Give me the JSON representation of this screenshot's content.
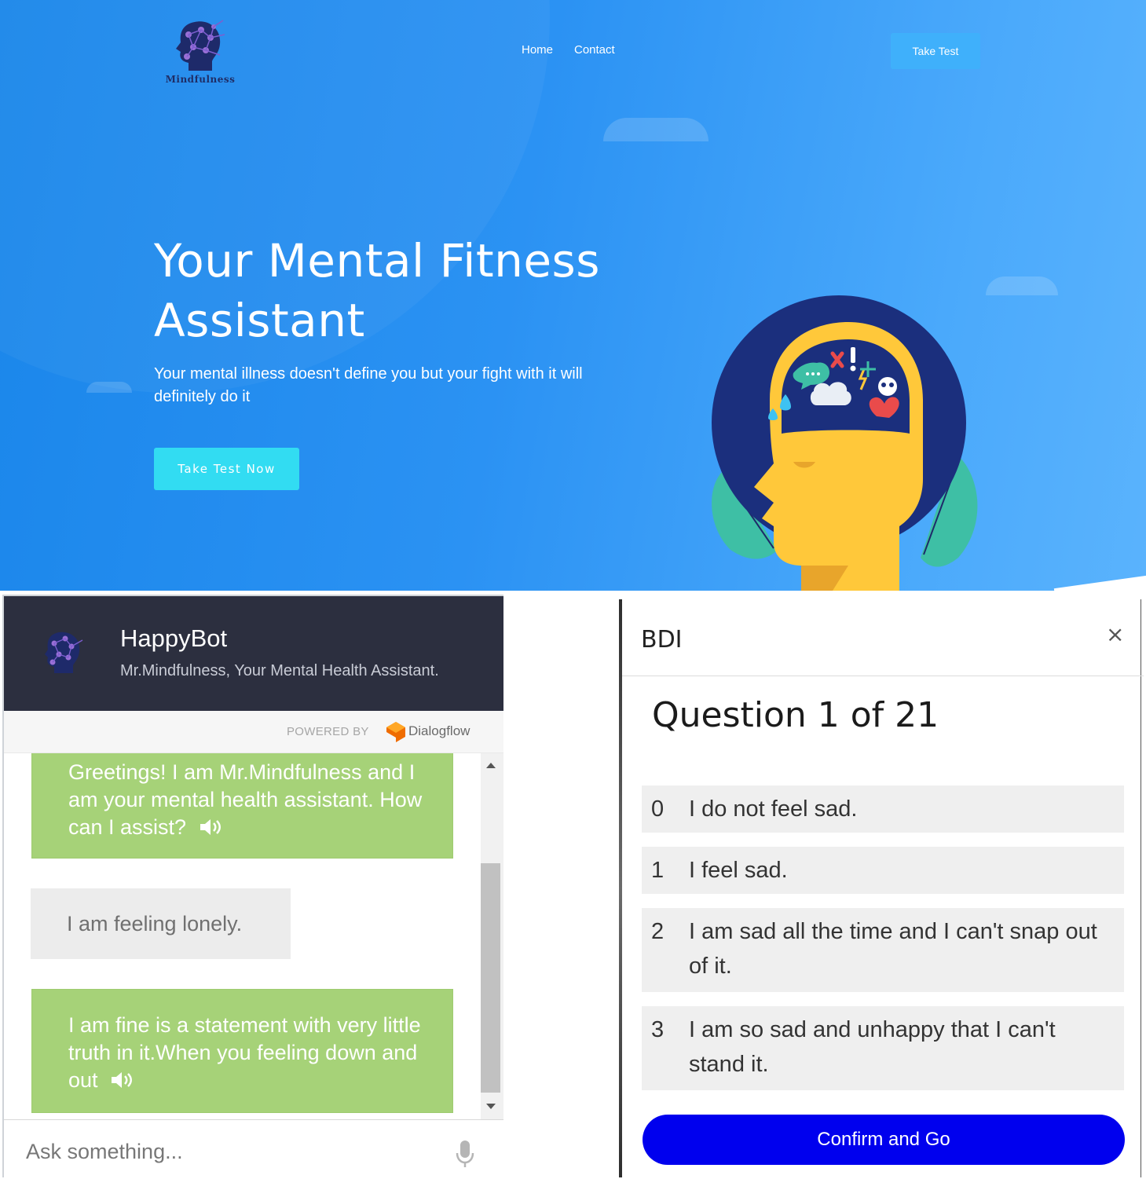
{
  "hero": {
    "logo_text": "Mindfulness",
    "nav": {
      "home": "Home",
      "contact": "Contact"
    },
    "take_test_label": "Take Test",
    "title_line1": "Your Mental Fitness",
    "title_line2": "Assistant",
    "subtitle": "Your mental illness doesn't define you but your fight with it will definitely do it",
    "cta_label": "Take Test Now",
    "colors": {
      "gradient_start": "#1a86ea",
      "gradient_end": "#5ab3fd",
      "cta": "#32dcf2",
      "take_test_btn": "#3fb0fb"
    }
  },
  "chat": {
    "title": "HappyBot",
    "subtitle": "Mr.Mindfulness, Your Mental Health Assistant.",
    "powered_by": "POWERED BY",
    "provider": "Dialogflow",
    "messages": [
      {
        "from": "bot",
        "text": "Greetings! I am Mr.Mindfulness and I am your mental health assistant. How can I assist?",
        "icon": "speaker-icon"
      },
      {
        "from": "user",
        "text": "I am feeling lonely."
      },
      {
        "from": "bot",
        "text": "I am fine is a statement with very little truth in it.When you feeling down and out",
        "icon": "speaker-icon"
      }
    ],
    "input_placeholder": "Ask something...",
    "colors": {
      "header": "#2c2f3f",
      "bot_bubble": "#a6d278",
      "user_bubble": "#ececec"
    }
  },
  "bdi": {
    "title": "BDI",
    "close": "×",
    "question": "Question 1 of 21",
    "options": [
      {
        "value": "0",
        "text": "I do not feel sad."
      },
      {
        "value": "1",
        "text": "I feel sad."
      },
      {
        "value": "2",
        "text": "I am sad all the time and I can't snap out of it."
      },
      {
        "value": "3",
        "text": "I am so sad and unhappy that I can't stand it."
      }
    ],
    "confirm_label": "Confirm and Go",
    "colors": {
      "confirm": "#0000ee",
      "option_bg": "#efefef"
    }
  }
}
